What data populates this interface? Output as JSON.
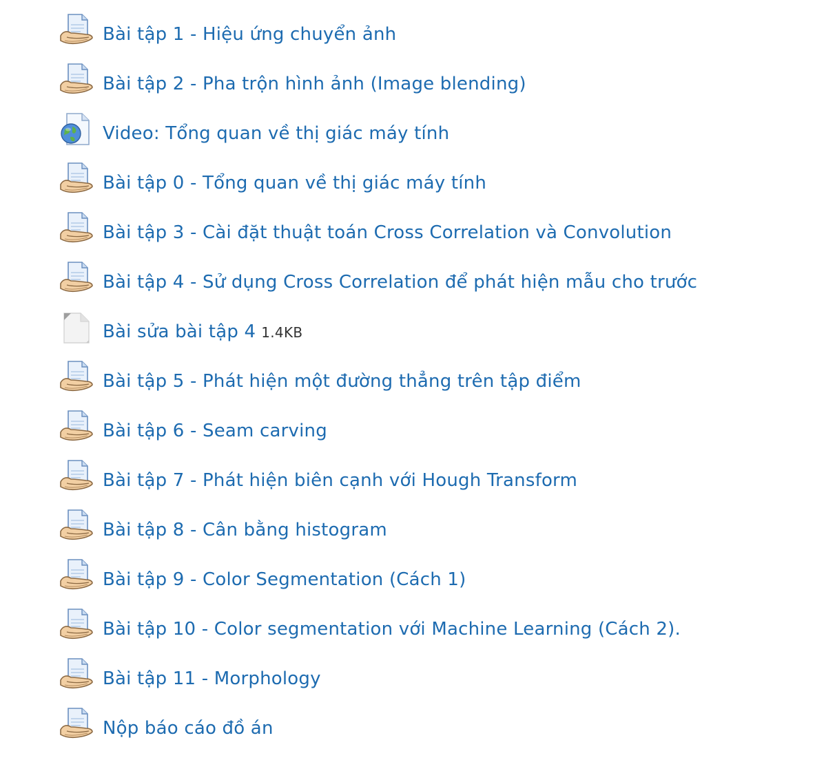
{
  "activities": [
    {
      "label": "Bài tập 1 - Hiệu ứng chuyển ảnh",
      "type": "assignment"
    },
    {
      "label": "Bài tập 2 - Pha trộn hình ảnh (Image blending)",
      "type": "assignment"
    },
    {
      "label": "Video: Tổng quan về thị giác máy tính",
      "type": "url"
    },
    {
      "label": "Bài tập 0 - Tổng quan về thị giác máy tính",
      "type": "assignment"
    },
    {
      "label": "Bài tập 3 - Cài đặt thuật toán Cross Correlation và Convolution",
      "type": "assignment"
    },
    {
      "label": "Bài tập 4 - Sử dụng Cross Correlation để phát hiện mẫu cho trước",
      "type": "assignment"
    },
    {
      "label": "Bài sửa bài tập 4",
      "type": "file",
      "size": "1.4KB"
    },
    {
      "label": "Bài tập 5 - Phát hiện một đường thẳng trên tập điểm",
      "type": "assignment"
    },
    {
      "label": "Bài tập 6 - Seam carving",
      "type": "assignment"
    },
    {
      "label": "Bài tập 7 - Phát hiện biên cạnh với Hough Transform",
      "type": "assignment"
    },
    {
      "label": "Bài tập 8 - Cân bằng histogram",
      "type": "assignment"
    },
    {
      "label": "Bài tập 9 - Color Segmentation (Cách 1)",
      "type": "assignment"
    },
    {
      "label": "Bài tập 10 - Color segmentation với Machine Learning (Cách 2).",
      "type": "assignment"
    },
    {
      "label": "Bài tập 11 - Morphology",
      "type": "assignment"
    },
    {
      "label": "Nộp báo cáo đồ án",
      "type": "assignment"
    }
  ],
  "colors": {
    "link": "#1d6bb0",
    "size_text": "#333333"
  },
  "icons": {
    "assignment": "assignment-icon",
    "url": "url-icon",
    "file": "file-icon"
  }
}
